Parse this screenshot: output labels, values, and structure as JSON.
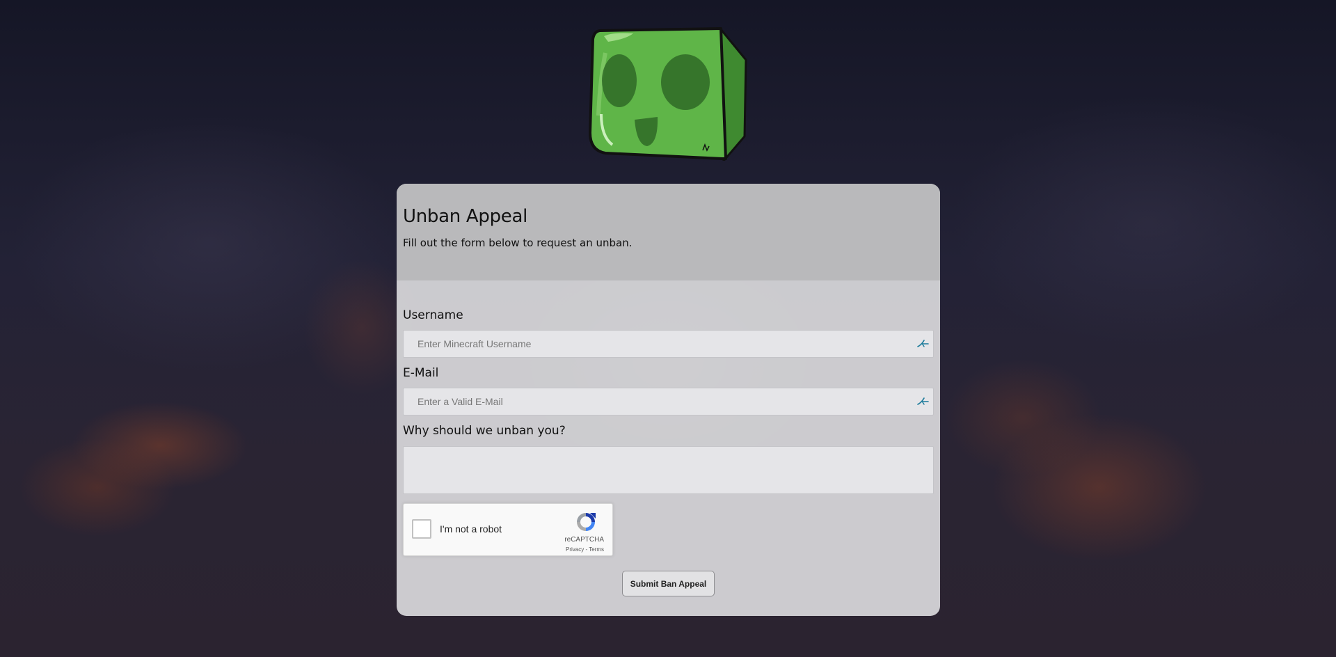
{
  "logo": {
    "icon": "slime-cube-logo"
  },
  "form": {
    "title": "Unban Appeal",
    "subtitle": "Fill out the form below to request an unban.",
    "username": {
      "label": "Username",
      "placeholder": "Enter Minecraft Username",
      "value": ""
    },
    "email": {
      "label": "E-Mail",
      "placeholder": "Enter a Valid E-Mail",
      "value": ""
    },
    "reason": {
      "label": "Why should we unban you?",
      "value": ""
    },
    "captcha": {
      "checkbox_label": "I'm not a robot",
      "brand": "reCAPTCHA",
      "privacy": "Privacy",
      "separator": " - ",
      "terms": "Terms",
      "checked": false
    },
    "submit_label": "Submit Ban Appeal"
  },
  "colors": {
    "accent_icon": "#1a7a9a",
    "slime_green": "#5fb548"
  }
}
